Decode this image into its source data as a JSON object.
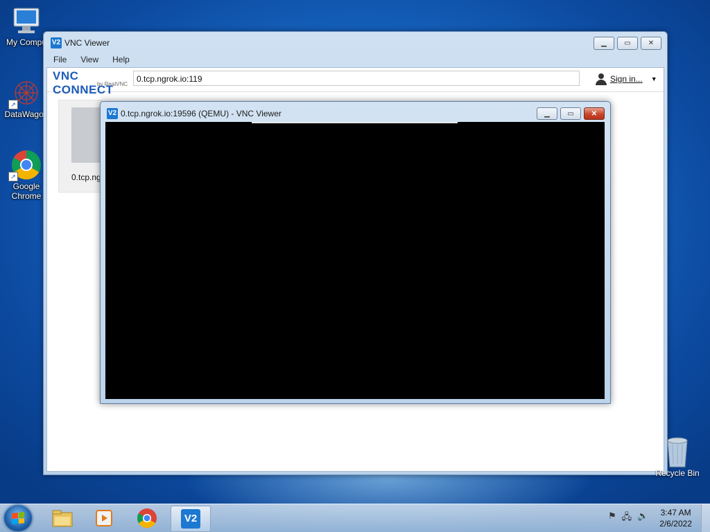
{
  "desktop": {
    "icons": [
      {
        "label": "My Compu",
        "icon": "computer-icon"
      },
      {
        "label": "DataWagon",
        "icon": "datawagon-icon"
      },
      {
        "label": "Google Chrome",
        "icon": "chrome-icon"
      }
    ],
    "recycle_bin": "Recycle Bin"
  },
  "main_window": {
    "title": "VNC Viewer",
    "menu": [
      "File",
      "View",
      "Help"
    ],
    "logo_main": "VNC CONNECT",
    "logo_sub": "by RealVNC",
    "address_value": "0.tcp.ngrok.io:119",
    "sign_in_label": "Sign in...",
    "connection_label": "0.tcp.ng"
  },
  "remote_window": {
    "title": "0.tcp.ngrok.io:19596 (QEMU) - VNC Viewer"
  },
  "taskbar": {
    "time": "3:47 AM",
    "date": "2/6/2022"
  },
  "colors": {
    "accent": "#1d78d1",
    "remote_bg": "#000000"
  }
}
